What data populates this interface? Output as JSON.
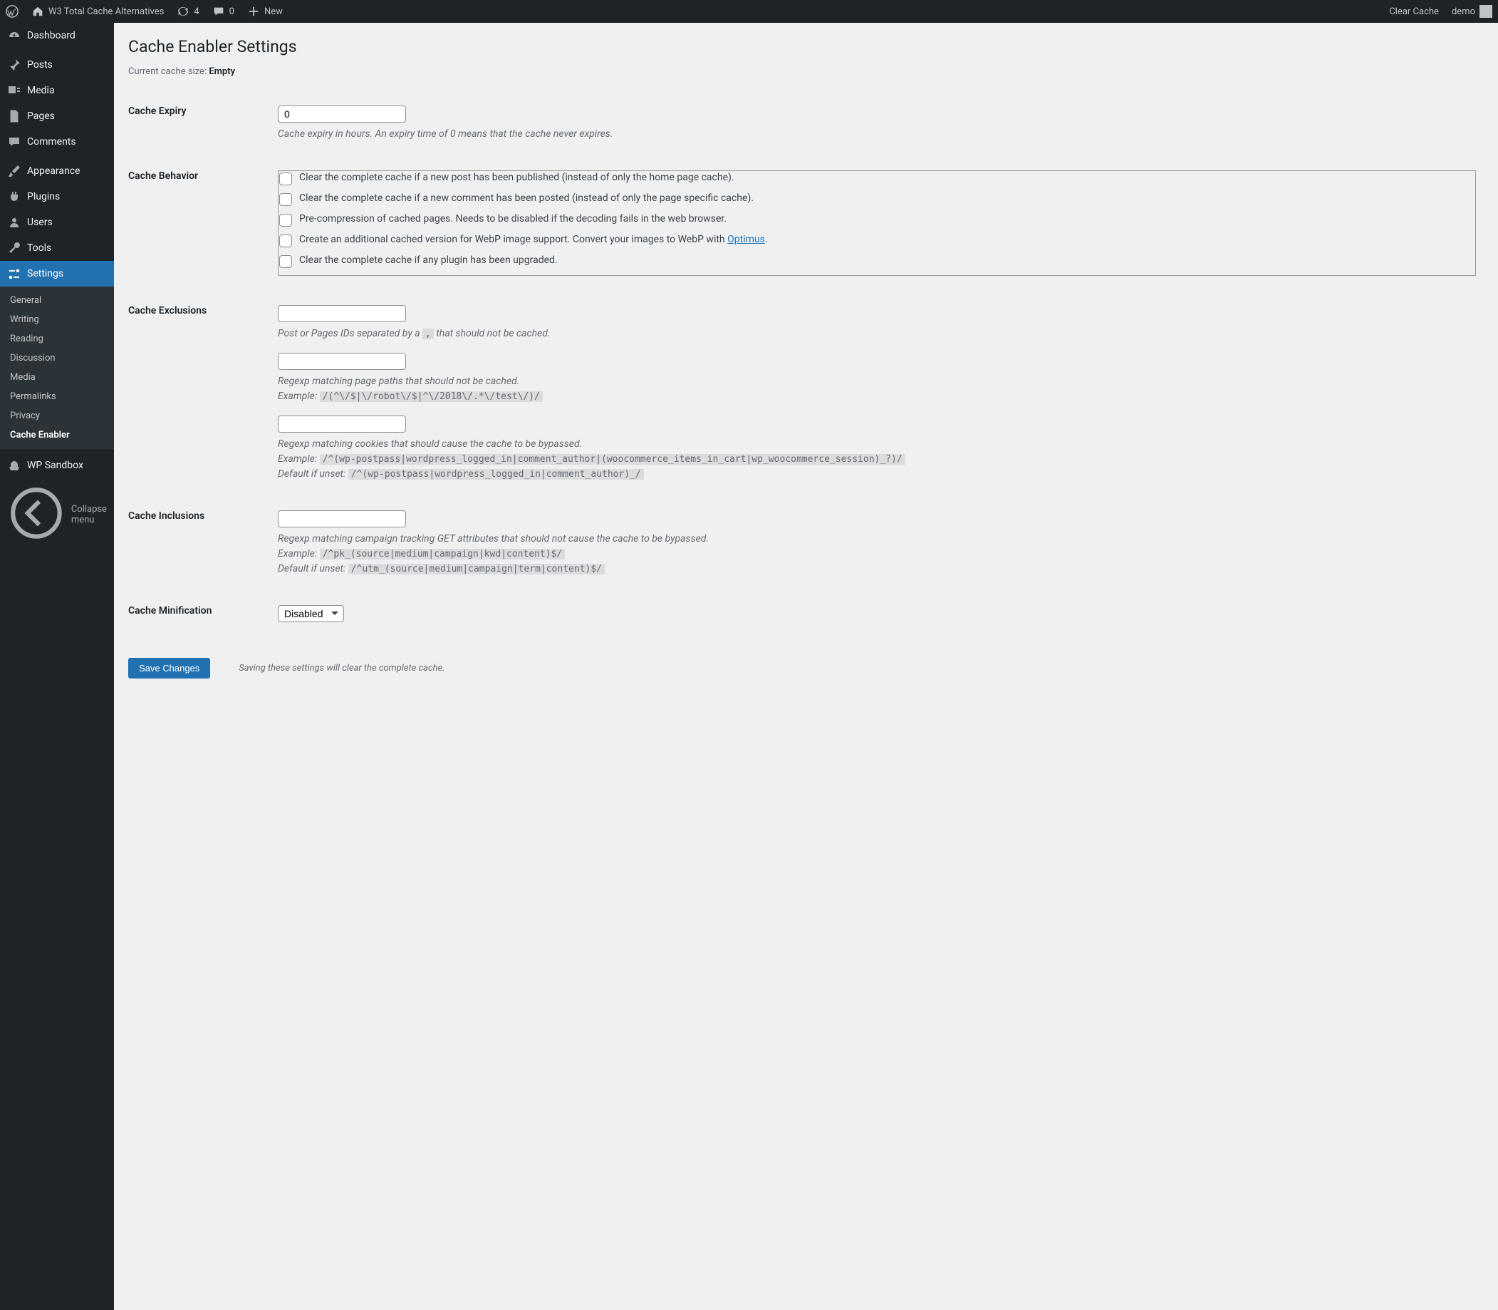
{
  "adminbar": {
    "site_title": "W3 Total Cache Alternatives",
    "updates_count": "4",
    "comments_count": "0",
    "new_label": "New",
    "clear_cache": "Clear Cache",
    "user": "demo"
  },
  "sidebar": {
    "items": [
      {
        "label": "Dashboard"
      },
      {
        "label": "Posts"
      },
      {
        "label": "Media"
      },
      {
        "label": "Pages"
      },
      {
        "label": "Comments"
      },
      {
        "label": "Appearance"
      },
      {
        "label": "Plugins"
      },
      {
        "label": "Users"
      },
      {
        "label": "Tools"
      },
      {
        "label": "Settings"
      },
      {
        "label": "WP Sandbox"
      }
    ],
    "settings_sub": [
      {
        "label": "General"
      },
      {
        "label": "Writing"
      },
      {
        "label": "Reading"
      },
      {
        "label": "Discussion"
      },
      {
        "label": "Media"
      },
      {
        "label": "Permalinks"
      },
      {
        "label": "Privacy"
      },
      {
        "label": "Cache Enabler"
      }
    ],
    "collapse": "Collapse menu"
  },
  "page": {
    "title": "Cache Enabler Settings",
    "size_label": "Current cache size: ",
    "size_value": "Empty"
  },
  "fields": {
    "expiry": {
      "label": "Cache Expiry",
      "value": "0",
      "desc": "Cache expiry in hours. An expiry time of 0 means that the cache never expires."
    },
    "behavior": {
      "label": "Cache Behavior",
      "cb1": "Clear the complete cache if a new post has been published (instead of only the home page cache).",
      "cb2": "Clear the complete cache if a new comment has been posted (instead of only the page specific cache).",
      "cb3": "Pre-compression of cached pages. Needs to be disabled if the decoding fails in the web browser.",
      "cb4_pre": "Create an additional cached version for WebP image support. Convert your images to WebP with ",
      "cb4_link": "Optimus",
      "cb4_post": ".",
      "cb5": "Clear the complete cache if any plugin has been upgraded."
    },
    "exclusions": {
      "label": "Cache Exclusions",
      "ids_value": "",
      "ids_desc_pre": "Post or Pages IDs separated by a ",
      "ids_desc_code": ",",
      "ids_desc_post": " that should not be cached.",
      "paths_value": "",
      "paths_desc": "Regexp matching page paths that should not be cached.",
      "paths_example_label": "Example: ",
      "paths_example_code": "/(^\\/$|\\/robot\\/$|^\\/2018\\/.*\\/test\\/)/",
      "cookies_value": "",
      "cookies_desc": "Regexp matching cookies that should cause the cache to be bypassed.",
      "cookies_example_label": "Example: ",
      "cookies_example_code": "/^(wp-postpass|wordpress_logged_in|comment_author|(woocommerce_items_in_cart|wp_woocommerce_session)_?)/",
      "cookies_default_label": "Default if unset: ",
      "cookies_default_code": "/^(wp-postpass|wordpress_logged_in|comment_author)_/"
    },
    "inclusions": {
      "label": "Cache Inclusions",
      "value": "",
      "desc": "Regexp matching campaign tracking GET attributes that should not cause the cache to be bypassed.",
      "example_label": "Example: ",
      "example_code": "/^pk_(source|medium|campaign|kwd|content)$/",
      "default_label": "Default if unset: ",
      "default_code": "/^utm_(source|medium|campaign|term|content)$/"
    },
    "minification": {
      "label": "Cache Minification",
      "selected": "Disabled"
    },
    "submit": {
      "button": "Save Changes",
      "note": "Saving these settings will clear the complete cache."
    }
  }
}
